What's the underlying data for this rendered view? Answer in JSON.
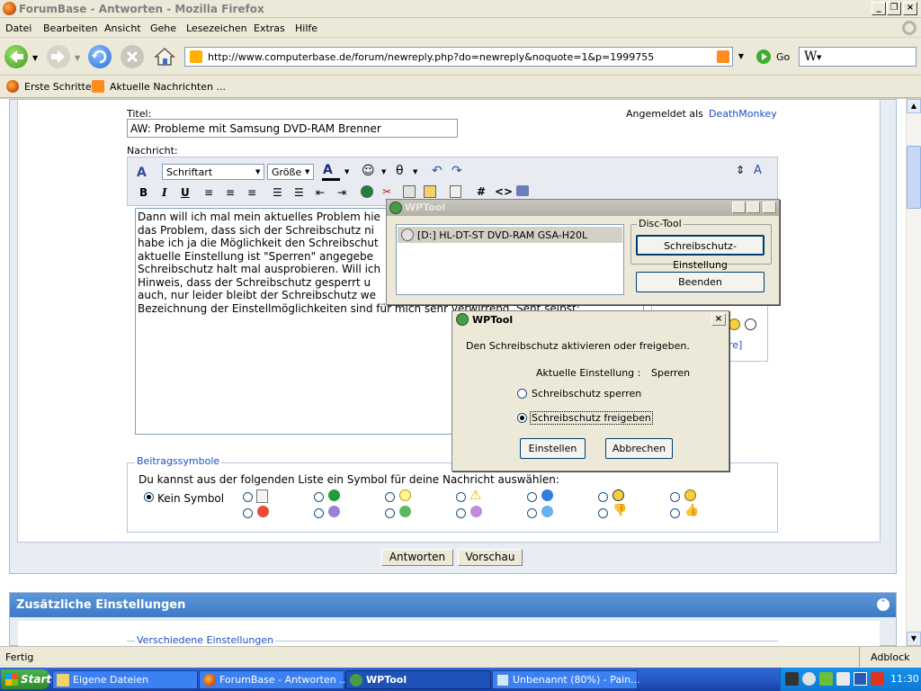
{
  "window": {
    "title": "ForumBase - Antworten - Mozilla Firefox"
  },
  "menu": [
    "Datei",
    "Bearbeiten",
    "Ansicht",
    "Gehe",
    "Lesezeichen",
    "Extras",
    "Hilfe"
  ],
  "nav": {
    "url": "http://www.computerbase.de/forum/newreply.php?do=newreply&noquote=1&p=1999755",
    "go_label": "Go",
    "search_value": "W"
  },
  "bookmarks": [
    "Erste Schritte",
    "Aktuelle Nachrichten ..."
  ],
  "form": {
    "title_label": "Titel:",
    "title_value": "AW: Probleme mit Samsung DVD-RAM Brenner",
    "logged_in_label": "Angemeldet als",
    "username": "DeathMonkey",
    "message_label": "Nachricht:",
    "font_select": "Schriftart",
    "size_select": "Größe",
    "message_lines": [
      "Dann will ich mal mein aktuelles Problem hie",
      "das Problem, dass sich der Schreibschutz ni",
      "habe ich ja die Möglichkeit den Schreibschut",
      "aktuelle Einstellung ist \"Sperren\" angegebe",
      "Schreibschutz halt mal ausprobieren. Will ich",
      "Hinweis, dass der Schreibschutz gesperrt u",
      "auch, nur leider bleibt der Schreibschutz we",
      "Bezeichnung der Einstellmöglichkeiten sind für mich sehr verwirrend. Seht selbst:"
    ],
    "smilies_more_fragment": "re]",
    "icons_legend": "Beitragssymbole",
    "icons_prompt": "Du kannst aus der folgenden Liste ein Symbol für deine Nachricht auswählen:",
    "no_icon_label": "Kein Symbol",
    "submit_label": "Antworten",
    "preview_label": "Vorschau"
  },
  "additional": {
    "title": "Zusätzliche Einstellungen",
    "section_legend": "Verschiedene Einstellungen"
  },
  "wptool": {
    "title": "WPTool",
    "drive_item": "[D:] HL-DT-ST DVD-RAM GSA-H20L",
    "group_label": "Disc-Tool",
    "settings_button": "Schreibschutz-Einstellung",
    "exit_button": "Beenden"
  },
  "dialog": {
    "title": "WPTool",
    "message": "Den Schreibschutz aktivieren oder freigeben.",
    "current_label": "Aktuelle Einstellung :",
    "current_value": "Sperren",
    "option_lock": "Schreibschutz sperren",
    "option_unlock": "Schreibschutz freigeben",
    "selected": "unlock",
    "apply_button": "Einstellen",
    "cancel_button": "Abbrechen"
  },
  "status": {
    "text": "Fertig",
    "adblock": "Adblock"
  },
  "taskbar": {
    "start": "Start",
    "tasks": [
      "Eigene Dateien",
      "ForumBase - Antworten ...",
      "WPTool",
      "Unbenannt (80%) - Pain..."
    ],
    "active_task": "WPTool",
    "clock": "11:30"
  },
  "colors": {
    "accent_blue": "#3d7ac6",
    "link": "#1a4fc4",
    "taskbar": "#2559c5"
  }
}
